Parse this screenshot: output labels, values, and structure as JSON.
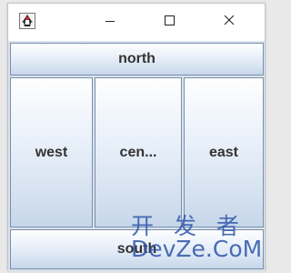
{
  "window": {
    "controls": {
      "minimize_icon": "minimize-icon",
      "maximize_icon": "maximize-icon",
      "close_icon": "close-icon"
    },
    "app_icon": "java-duke-icon"
  },
  "layout": {
    "north": "north",
    "west": "west",
    "center": "cen...",
    "east": "east",
    "south": "south"
  },
  "watermark": {
    "line1": "开 发 者",
    "line2": "DevZe.CoM"
  },
  "colors": {
    "button_border": "#7b8fa8",
    "watermark": "#2f55a8"
  }
}
